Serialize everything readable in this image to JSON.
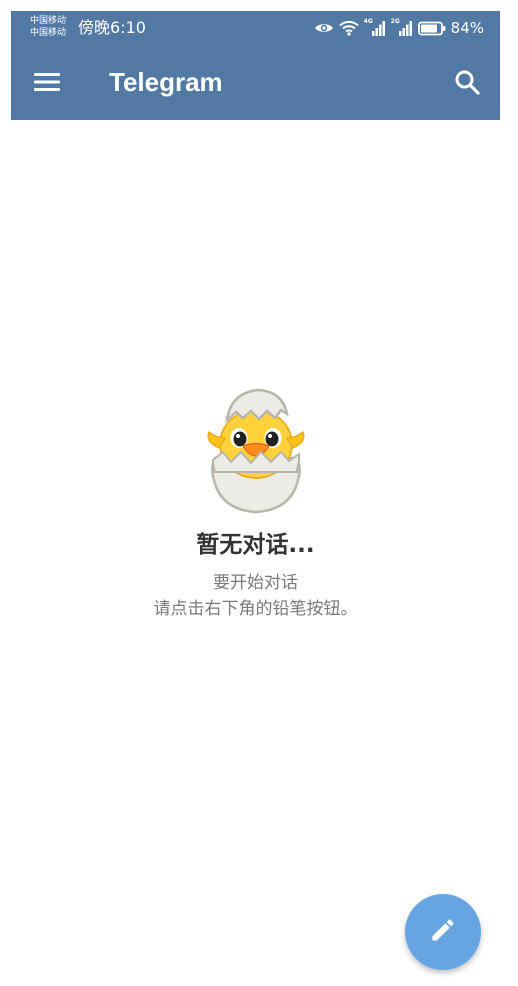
{
  "status_bar": {
    "carrier_1": "中国移动",
    "carrier_2": "中国移动",
    "time": "傍晚6:10",
    "network_1": "4G",
    "network_2": "2G",
    "battery_percent": "84%",
    "battery_level": 0.84,
    "icons": [
      "eye-icon",
      "wifi-icon",
      "signal-4g-icon",
      "signal-2g-icon",
      "battery-icon"
    ]
  },
  "app_bar": {
    "title": "Telegram",
    "menu_icon": "menu-icon",
    "search_icon": "search-icon"
  },
  "empty_state": {
    "illustration": "hatching-chick-sticker",
    "title": "暂无对话...",
    "line_1": "要开始对话",
    "line_2": "请点击右下角的铅笔按钮。"
  },
  "fab": {
    "icon": "pencil-icon"
  },
  "colors": {
    "app_bar": "#5279a3",
    "fab": "#67a5e2",
    "title_text": "#333333",
    "body_text": "#7a7a7a",
    "background": "#ffffff"
  }
}
